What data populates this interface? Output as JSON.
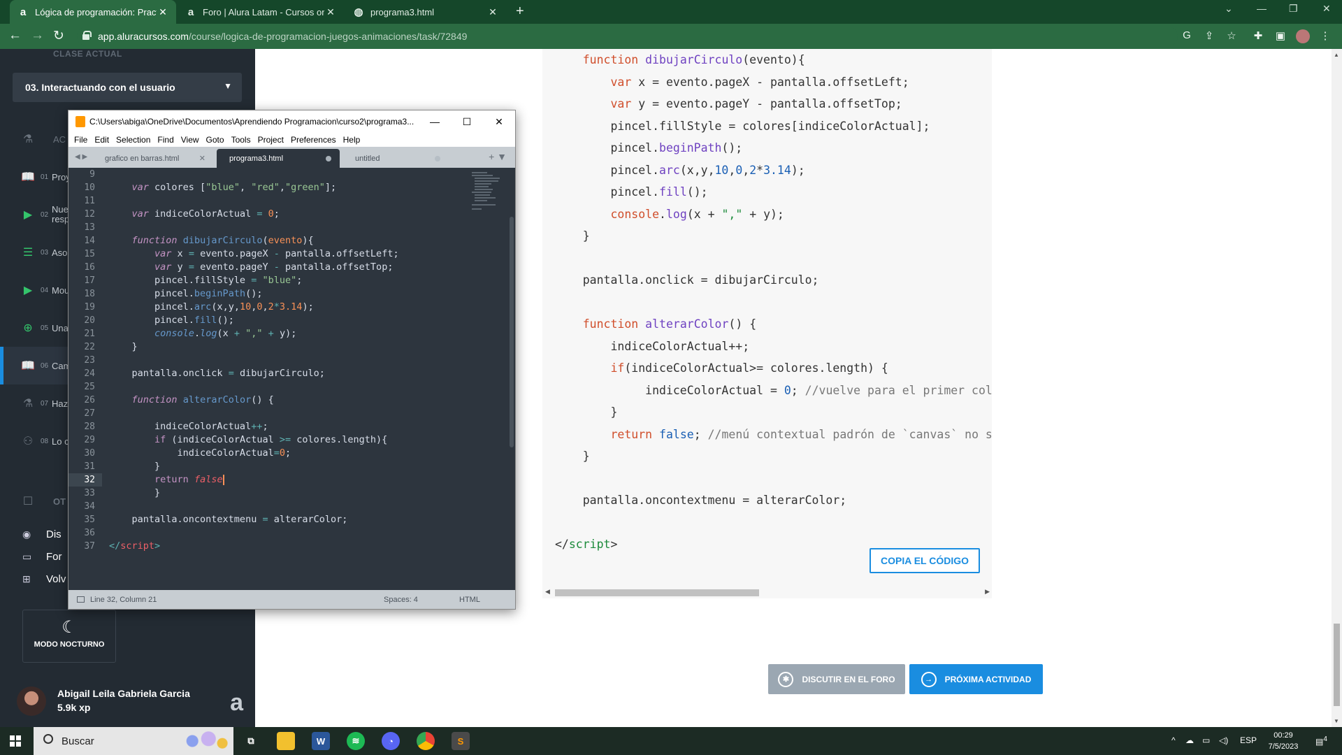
{
  "browser": {
    "tabs": [
      {
        "label": "Lógica de programación: Practica",
        "favicon": "a"
      },
      {
        "label": "Foro | Alura Latam - Cursos onlin",
        "favicon": "a"
      },
      {
        "label": "programa3.html",
        "favicon": "globe"
      }
    ],
    "url_host": "app.aluracursos.com",
    "url_path": "/course/logica-de-programacion-juegos-animaciones/task/72849"
  },
  "sidebar": {
    "current_label": "CLASE ACTUAL",
    "lesson_select": "03. Interactuando con el usuario",
    "items": [
      {
        "num": "",
        "label": "AC",
        "icon": "flask-icon"
      },
      {
        "num": "01",
        "label": "Proy",
        "icon": "book-icon"
      },
      {
        "num": "02",
        "label": "Nue\nresp",
        "icon": "play-icon"
      },
      {
        "num": "03",
        "label": "Aso",
        "icon": "list-icon"
      },
      {
        "num": "04",
        "label": "Mou",
        "icon": "play-icon"
      },
      {
        "num": "05",
        "label": "Una",
        "icon": "plus-circle-icon"
      },
      {
        "num": "06",
        "label": "Cam",
        "icon": "book-icon"
      },
      {
        "num": "07",
        "label": "Haz",
        "icon": "flask-icon"
      },
      {
        "num": "08",
        "label": "Lo c",
        "icon": "people-icon"
      }
    ],
    "other_label": "OT",
    "links": [
      {
        "label": "Dis",
        "icon": "discord-icon"
      },
      {
        "label": "For",
        "icon": "chat-icon"
      },
      {
        "label": "Volv",
        "icon": "grid-icon"
      }
    ],
    "night_mode": "MODO NOCTURNO",
    "user_name": "Abigail Leila Gabriela Garcia",
    "user_xp": "5.9k xp"
  },
  "sublime": {
    "title": "C:\\Users\\abiga\\OneDrive\\Documentos\\Aprendiendo Programacion\\curso2\\programa3...",
    "menu": [
      "File",
      "Edit",
      "Selection",
      "Find",
      "View",
      "Goto",
      "Tools",
      "Project",
      "Preferences",
      "Help"
    ],
    "tabs": [
      "grafico en barras.html",
      "programa3.html",
      "untitled"
    ],
    "line_numbers": [
      "9",
      "10",
      "11",
      "12",
      "13",
      "14",
      "15",
      "16",
      "17",
      "18",
      "19",
      "20",
      "21",
      "22",
      "23",
      "24",
      "25",
      "26",
      "27",
      "28",
      "29",
      "30",
      "31",
      "32",
      "33",
      "34",
      "35",
      "36",
      "37"
    ],
    "current_line": "32",
    "status_position": "Line 32, Column 21",
    "status_spaces": "Spaces: 4",
    "status_syntax": "HTML"
  },
  "page": {
    "copy_button": "COPIA EL CÓDIGO",
    "forum_button": "DISCUTIR EN EL FORO",
    "next_button": "PRÓXIMA ACTIVIDAD"
  },
  "taskbar": {
    "search_placeholder": "Buscar",
    "lang": "ESP",
    "time": "00:29",
    "date": "7/5/2023",
    "notif_count": "4"
  }
}
